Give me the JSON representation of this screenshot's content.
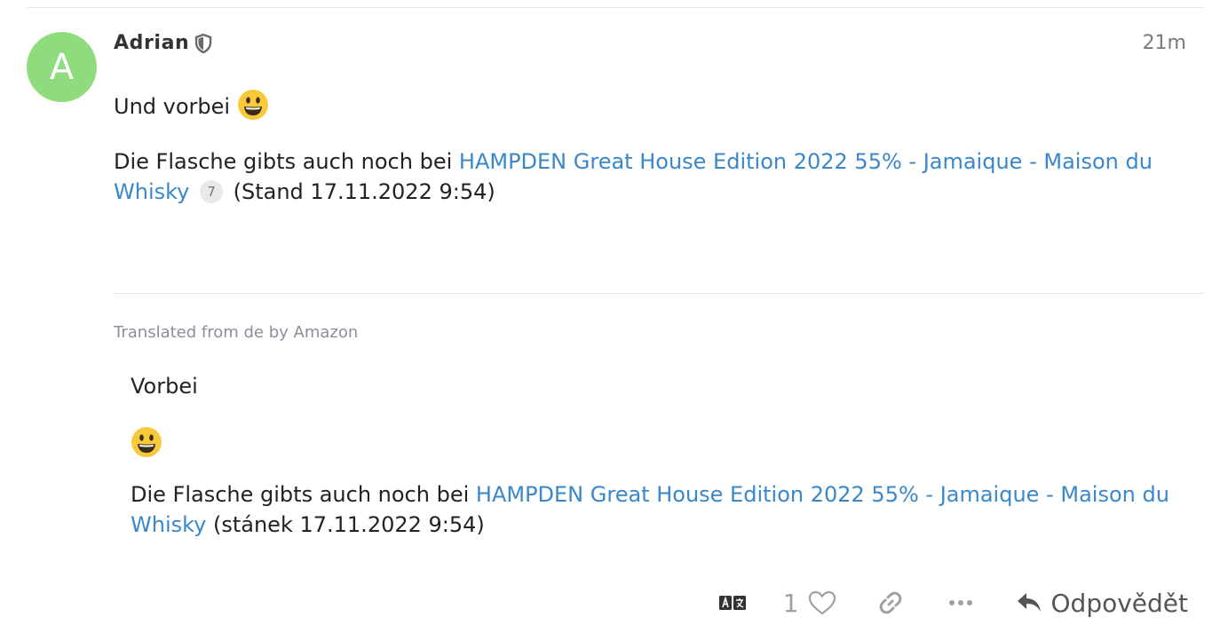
{
  "post": {
    "avatar_letter": "A",
    "avatar_color": "#8fdc7e",
    "username": "Adrian",
    "user_badge_icon": "shield-icon",
    "timestamp": "21m",
    "paragraph1_text": "Und vorbei",
    "paragraph2_prefix": "Die Flasche gibts auch noch bei ",
    "link_text": "HAMPDEN Great House Edition 2022 55% - Jamaique - Maison du Whisky",
    "link_clicks": "7",
    "paragraph2_suffix": " (Stand 17.11.2022 9:54)"
  },
  "translation": {
    "attribution": "Translated from de by Amazon",
    "line1": "Vorbei",
    "paragraph_prefix": "Die Flasche gibts auch noch bei ",
    "link_text": "HAMPDEN Great House Edition 2022 55% - Jamaique - Maison du Whisky",
    "paragraph_suffix": " (stánek 17.11.2022 9:54)"
  },
  "actions": {
    "translate_icon": "translate-icon",
    "like_count": "1",
    "like_icon": "heart-icon",
    "link_icon": "link-icon",
    "more_icon": "ellipsis-icon",
    "reply_icon": "reply-icon",
    "reply_label": "Odpovědět"
  },
  "colors": {
    "link": "#3a87c9",
    "muted": "#999999",
    "divider": "#e9e9e9"
  }
}
